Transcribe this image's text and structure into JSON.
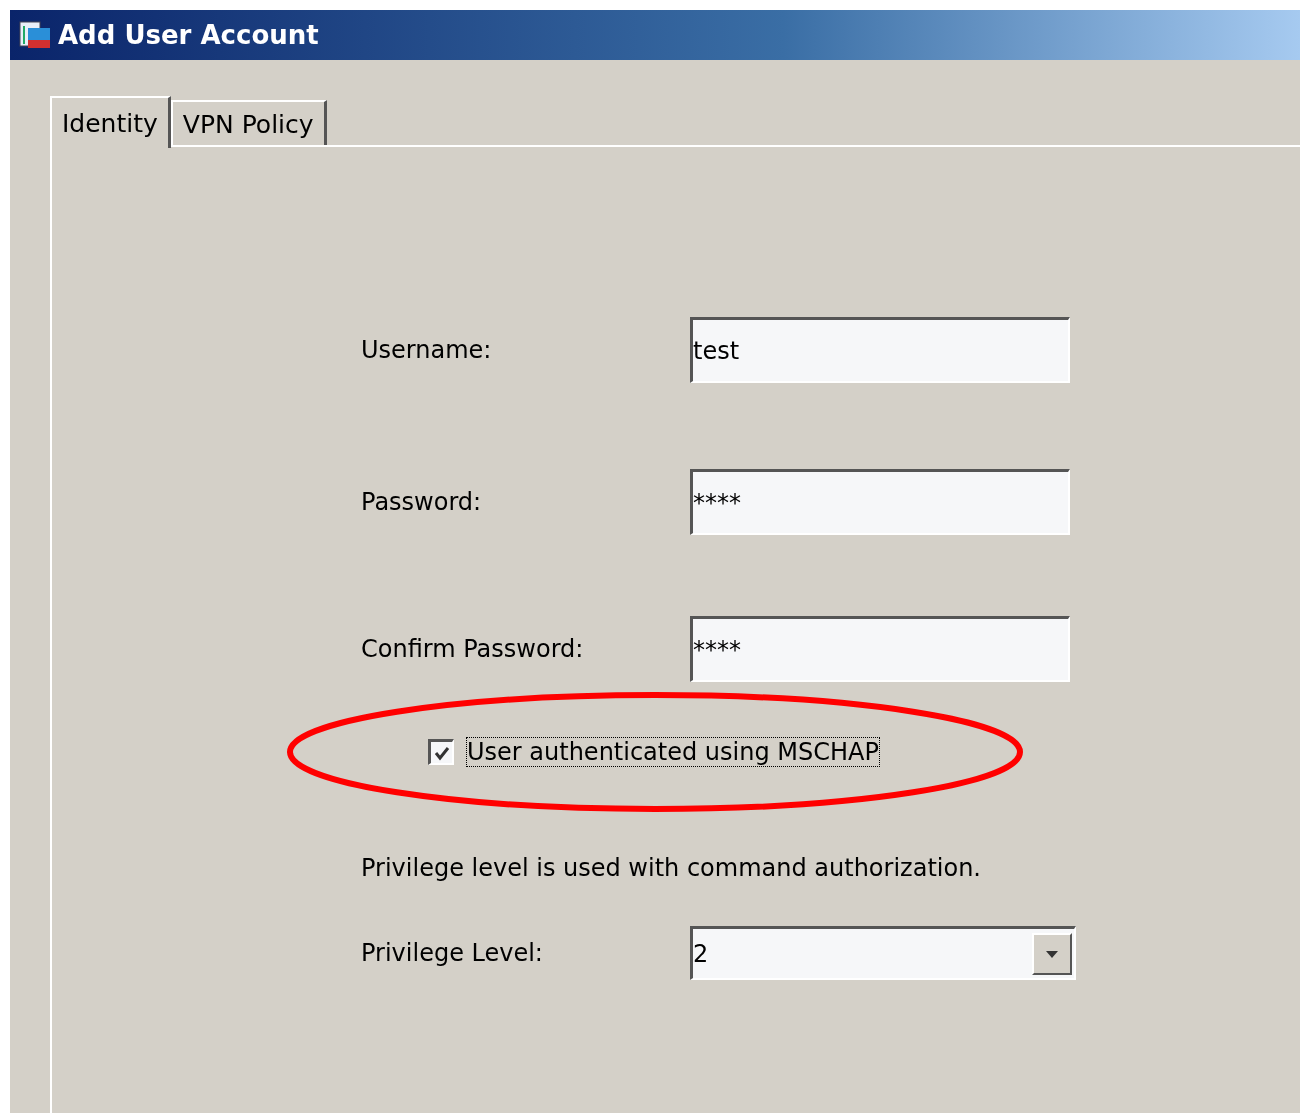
{
  "window": {
    "title": "Add User Account"
  },
  "tabs": [
    {
      "label": "Identity",
      "selected": true
    },
    {
      "label": "VPN Policy",
      "selected": false
    }
  ],
  "fields": [
    {
      "label": "Username:",
      "value": "test"
    },
    {
      "label": "Password:",
      "value": "****"
    },
    {
      "label": "Confirm Password:",
      "value": "****"
    }
  ],
  "mschap": {
    "label": "User authenticated using MSCHAP",
    "checked": true,
    "highlighted": true
  },
  "privilege_note": "Privilege level is used with command authorization.",
  "privilege_level": {
    "label": "Privilege Level:",
    "value": "2"
  }
}
